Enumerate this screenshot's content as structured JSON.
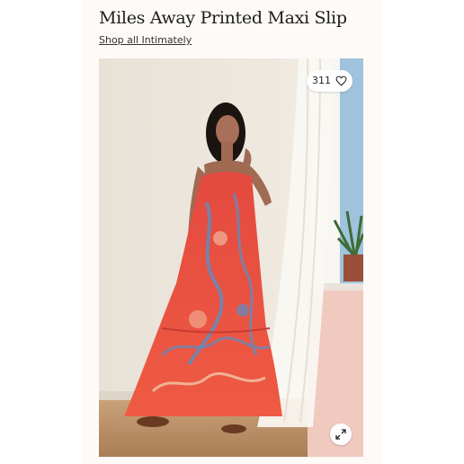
{
  "product": {
    "title": "Miles Away Printed Maxi Slip",
    "shop_link": "Shop all Intimately"
  },
  "image": {
    "like_count": "311",
    "like_icon": "heart-icon",
    "expand_icon": "expand-arrows-icon",
    "dress_color": "#e8453c",
    "background_color": "#ece6dd"
  }
}
